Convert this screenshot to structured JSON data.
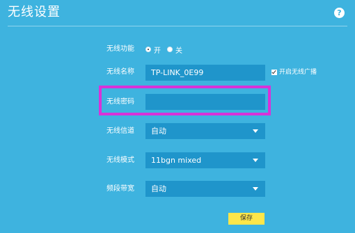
{
  "header": {
    "title": "无线设置",
    "help_label": "?"
  },
  "form": {
    "wireless_function": {
      "label": "无线功能",
      "options": [
        {
          "label": "开",
          "checked": true
        },
        {
          "label": "关",
          "checked": false
        }
      ]
    },
    "ssid": {
      "label": "无线名称",
      "value": "TP-LINK_0E99",
      "broadcast_label": "开启无线广播",
      "broadcast_checked": true
    },
    "password": {
      "label": "无线密码",
      "value": ""
    },
    "channel": {
      "label": "无线信道",
      "value": "自动"
    },
    "mode": {
      "label": "无线模式",
      "value": "11bgn mixed"
    },
    "bandwidth": {
      "label": "频段带宽",
      "value": "自动"
    }
  },
  "actions": {
    "save_label": "保存"
  },
  "colors": {
    "background": "#3eb3df",
    "field": "#1f95cb",
    "highlight": "#d832d8",
    "save_button": "#fde64a"
  }
}
